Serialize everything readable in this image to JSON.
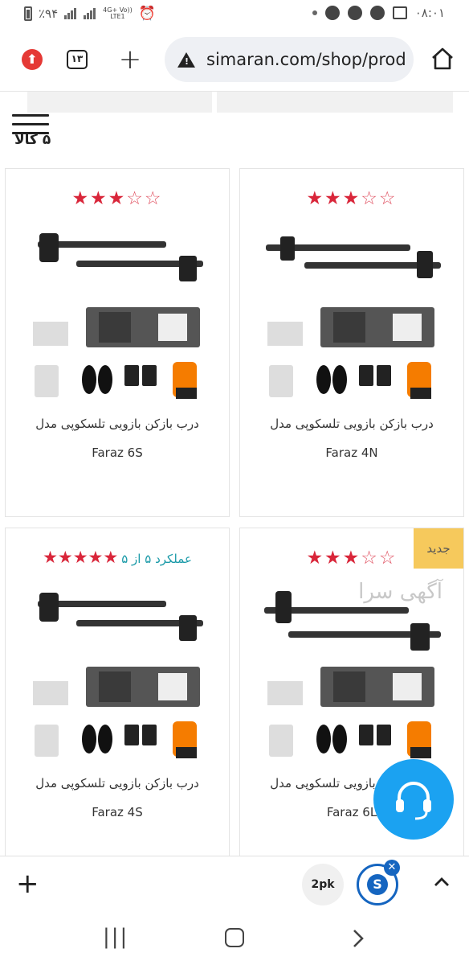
{
  "status_bar": {
    "battery_percent": "٪۹۴",
    "network": "4G+ Vo)) LTE1",
    "time": "۰۸:۰۱"
  },
  "browser": {
    "tab_count": "۱۳",
    "url": "simaran.com/shop/prod"
  },
  "page": {
    "product_count_label": "۵ کالا",
    "products": [
      {
        "title": "درب بازکن بازویی تلسکوپی مدل",
        "model": "Faraz 4N",
        "stars_filled": 3,
        "stars_total": 5,
        "badge": "",
        "rating_text": ""
      },
      {
        "title": "درب بازکن بازویی تلسکوپی مدل",
        "model": "Faraz 6S",
        "stars_filled": 3,
        "stars_total": 5,
        "badge": "",
        "rating_text": ""
      },
      {
        "title": "درب بازکن بازویی تلسکوپی مدل",
        "model": "Faraz 6L",
        "stars_filled": 3,
        "stars_total": 5,
        "badge": "جدید",
        "watermark": "آگهی سرا",
        "rating_text": ""
      },
      {
        "title": "درب بازکن بازویی تلسکوپی مدل",
        "model": "Faraz 4S",
        "stars_filled": 5,
        "stars_total": 5,
        "badge": "",
        "rating_text": "عملکرد ۵ از ۵"
      }
    ]
  },
  "bottom_bar": {
    "extension_label": "2pk",
    "s_icon": "S"
  },
  "colors": {
    "star": "#d9263a",
    "badge": "#f6c95c",
    "support": "#1ba2f1",
    "accent_blue": "#1565c0",
    "rating_text": "#1a9aa8"
  }
}
